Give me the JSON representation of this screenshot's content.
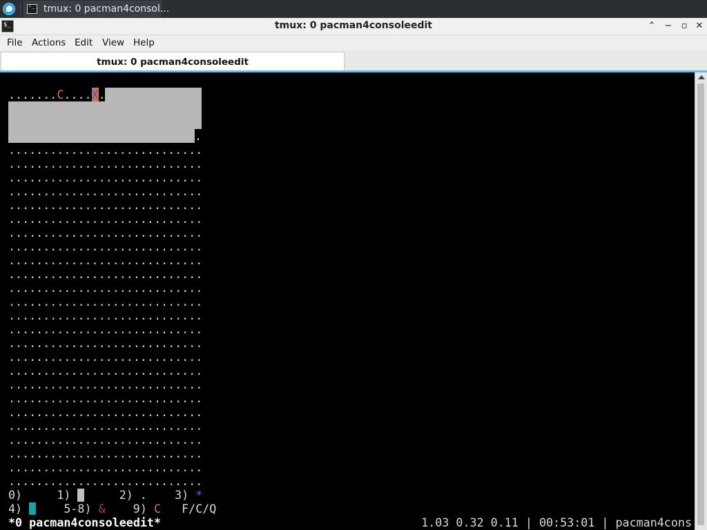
{
  "taskbar": {
    "task_title": "tmux: 0 pacman4consol..."
  },
  "window": {
    "title": "tmux: 0 pacman4consoleedit",
    "controls": {
      "keep_above": "⌃",
      "minimize": "−",
      "maximize": "▫",
      "close": "✕"
    }
  },
  "menubar": {
    "items": [
      "File",
      "Actions",
      "Edit",
      "View",
      "Help"
    ]
  },
  "tabs": [
    {
      "label": "tmux: 0 pacman4consoleedit",
      "active": true
    }
  ],
  "game": {
    "row0": {
      "prefix": ".......",
      "ghost": "C",
      "mid": "....",
      "player": "X",
      "suffix": "."
    },
    "row3_tail": ".",
    "dot_row": "............................",
    "dot_row_count": 25
  },
  "legend": {
    "line1": {
      "k0": "0)",
      "k1": "1)",
      "k2": "2) .",
      "k3": "3)",
      "k3_glyph": "*"
    },
    "line2": {
      "k4": "4)",
      "k58": "5-8)",
      "k58_glyph": "&",
      "k9": "9)",
      "k9_glyph": "C",
      "keys": "F/C/Q"
    }
  },
  "status": {
    "left": "*0 pacman4consoleedit*",
    "right": "1.03 0.32 0.11 | 00:53:01 | pacman4cons"
  },
  "colors": {
    "ghost": "#c77a3c",
    "player_bg": "#c77a3c",
    "player_fg": "#4a4aff",
    "power_pellet": "#5b5bff",
    "ampersand": "#c03a3a",
    "accent": "#6fb6e6"
  }
}
